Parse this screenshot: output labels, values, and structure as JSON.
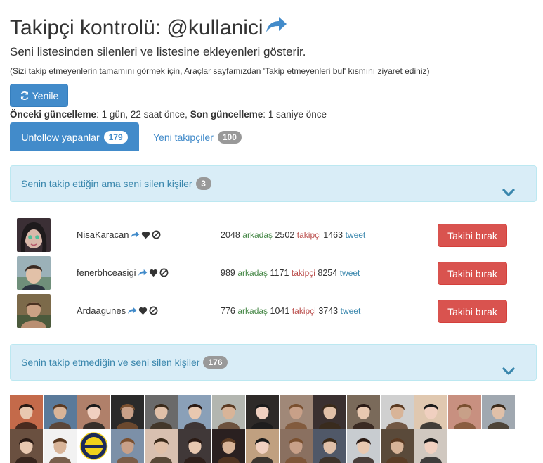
{
  "header": {
    "title": "Takipçi kontrolü: @kullanici",
    "subtitle": "Seni listesinden silenleri ve listesine ekleyenleri gösterir.",
    "note": "(Sizi takip etmeyenlerin tamamını görmek için, Araçlar sayfamızdan 'Takip etmeyenleri bul' kısmını ziyaret ediniz)"
  },
  "refresh": {
    "label": "Yenile"
  },
  "updates": {
    "prev_label": "Önceki güncelleme",
    "prev_value": ": 1 gün, 22 saat önce,",
    "last_label": "Son güncelleme",
    "last_value": ": 1 saniye önce"
  },
  "tabs": [
    {
      "label": "Unfollow yapanlar",
      "count": "179",
      "active": true
    },
    {
      "label": "Yeni takipçiler",
      "count": "100",
      "active": false
    }
  ],
  "panels": [
    {
      "label": "Senin takip ettiğin ama seni silen kişiler",
      "count": "3"
    },
    {
      "label": "Senin takip etmediğin ve seni silen kişiler",
      "count": "176"
    }
  ],
  "users": [
    {
      "name": "NisaKaracan",
      "friends": "2048",
      "followers": "2502",
      "tweets": "1463"
    },
    {
      "name": "fenerbhceasigi",
      "friends": "989",
      "followers": "1171",
      "tweets": "8254"
    },
    {
      "name": "Ardaagunes",
      "friends": "776",
      "followers": "1041",
      "tweets": "3743"
    }
  ],
  "stat_words": {
    "friends": "arkadaş",
    "followers": "takipçi",
    "tweets": "tweet"
  },
  "unfollow_label": "Takibi bırak",
  "colors": {
    "primary": "#428bca",
    "danger": "#d9534f",
    "info_bg": "#d9edf7",
    "info_text": "#3a87ad",
    "friends": "#468847",
    "followers": "#b94a48"
  },
  "icons": [
    "share-icon",
    "refresh-icon",
    "heart-icon",
    "ban-icon",
    "chevron-down-icon"
  ]
}
